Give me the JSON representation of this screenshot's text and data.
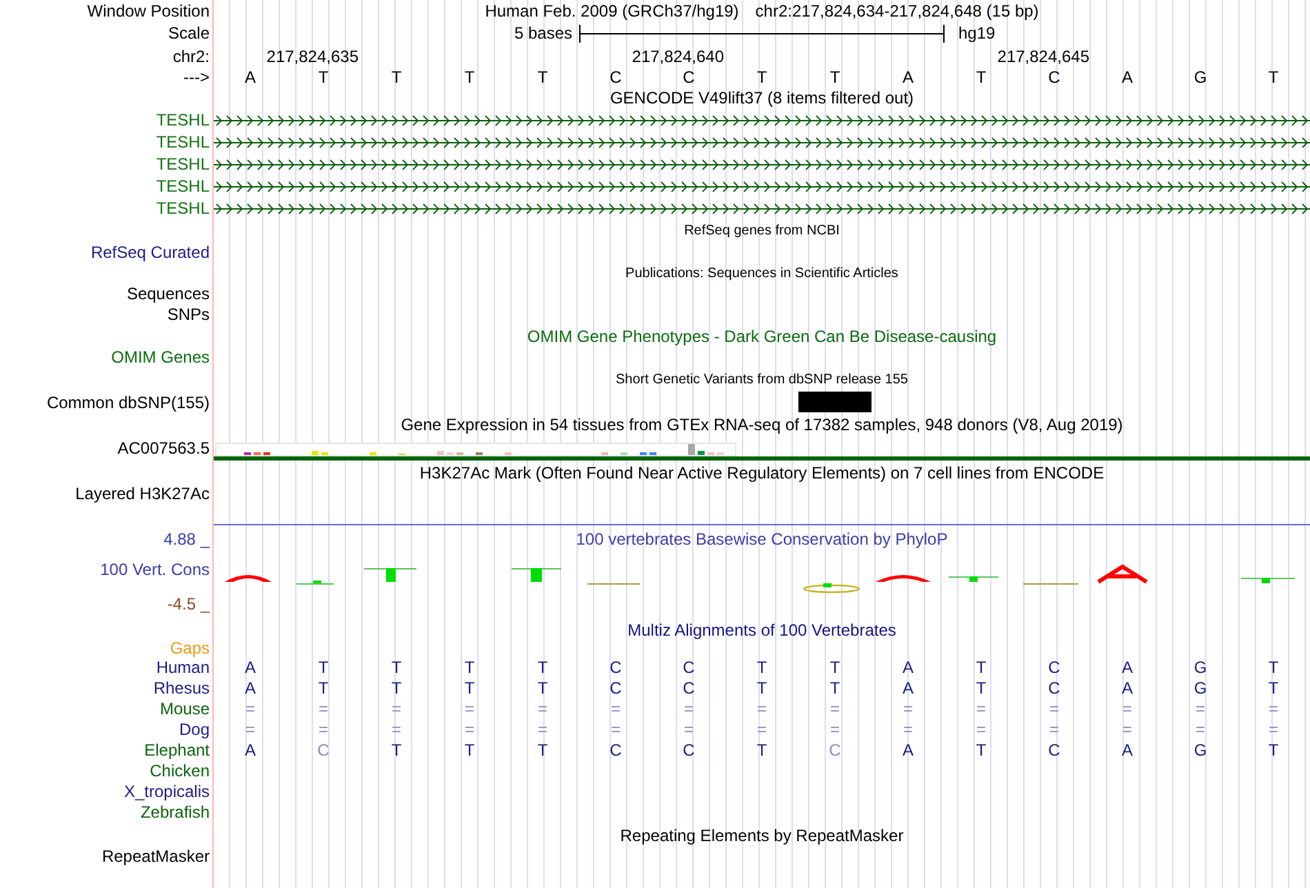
{
  "header": {
    "label": "Window Position",
    "assembly": "Human Feb. 2009 (GRCh37/hg19)",
    "position": "chr2:217,824,634-217,824,648 (15 bp)"
  },
  "scale": {
    "label": "Scale",
    "bar_label": "5 bases",
    "assembly": "hg19"
  },
  "ruler": {
    "label": "chr2:",
    "ticks": [
      "217,824,635",
      "217,824,640",
      "217,824,645"
    ]
  },
  "sequence": {
    "label": "--->",
    "bases": [
      "A",
      "T",
      "T",
      "T",
      "T",
      "C",
      "C",
      "T",
      "T",
      "A",
      "T",
      "C",
      "A",
      "G",
      "T"
    ]
  },
  "tracks": [
    {
      "kind": "gene",
      "title": "GENCODE V49lift37 (8 items filtered out)",
      "items": [
        {
          "label": "TESHL"
        },
        {
          "label": "TESHL"
        },
        {
          "label": "TESHL"
        },
        {
          "label": "TESHL"
        },
        {
          "label": "TESHL"
        }
      ]
    },
    {
      "kind": "refseq",
      "title": "RefSeq genes from NCBI",
      "labels": [
        "RefSeq Curated"
      ]
    },
    {
      "kind": "publications",
      "title": "Publications: Sequences in Scientific Articles",
      "labels": [
        "Sequences",
        "SNPs"
      ]
    },
    {
      "kind": "omim",
      "title": "OMIM Gene Phenotypes - Dark Green Can Be Disease-causing",
      "labels": [
        "OMIM Genes"
      ]
    },
    {
      "kind": "variants",
      "title": "Short Genetic Variants from dbSNP release 155",
      "labels": [
        "Common dbSNP(155)"
      ]
    },
    {
      "kind": "expression",
      "title": "Gene Expression in 54 tissues from GTEx RNA-seq of 17382 samples, 948 donors (V8, Aug 2019)",
      "labels": [
        "AC007563.5"
      ]
    },
    {
      "kind": "signal",
      "title": "H3K27Ac Mark (Often Found Near Active Regulatory Elements) on 7 cell lines from ENCODE",
      "labels": [
        "Layered H3K27Ac"
      ]
    },
    {
      "kind": "conservation",
      "title": "100 vertebrates Basewise Conservation by PhyloP",
      "labels": [
        "100 Vert. Cons"
      ],
      "max_label": "4.88 _",
      "min_label": "-4.5 _"
    },
    {
      "kind": "alignment",
      "title": "Multiz Alignments of 100 Vertebrates",
      "labels": [
        "Gaps"
      ],
      "species": [
        {
          "name": "Human",
          "color": "#1c1c84",
          "bases": [
            {
              "base": "A",
              "faded": false
            },
            {
              "base": "T",
              "faded": false
            },
            {
              "base": "T",
              "faded": false
            },
            {
              "base": "T",
              "faded": false
            },
            {
              "base": "T",
              "faded": false
            },
            {
              "base": "C",
              "faded": false
            },
            {
              "base": "C",
              "faded": false
            },
            {
              "base": "T",
              "faded": false
            },
            {
              "base": "T",
              "faded": false
            },
            {
              "base": "A",
              "faded": false
            },
            {
              "base": "T",
              "faded": false
            },
            {
              "base": "C",
              "faded": false
            },
            {
              "base": "A",
              "faded": false
            },
            {
              "base": "G",
              "faded": false
            },
            {
              "base": "T",
              "faded": false
            }
          ]
        },
        {
          "name": "Rhesus",
          "color": "#1c1c84",
          "bases": [
            {
              "base": "A",
              "faded": false
            },
            {
              "base": "T",
              "faded": false
            },
            {
              "base": "T",
              "faded": false
            },
            {
              "base": "T",
              "faded": false
            },
            {
              "base": "T",
              "faded": false
            },
            {
              "base": "C",
              "faded": false
            },
            {
              "base": "C",
              "faded": false
            },
            {
              "base": "T",
              "faded": false
            },
            {
              "base": "T",
              "faded": false
            },
            {
              "base": "A",
              "faded": false
            },
            {
              "base": "T",
              "faded": false
            },
            {
              "base": "C",
              "faded": false
            },
            {
              "base": "A",
              "faded": false
            },
            {
              "base": "G",
              "faded": false
            },
            {
              "base": "T",
              "faded": false
            }
          ]
        },
        {
          "name": "Mouse",
          "color": "#0c640c",
          "bases": [
            {
              "base": "=",
              "faded": true
            },
            {
              "base": "=",
              "faded": true
            },
            {
              "base": "=",
              "faded": true
            },
            {
              "base": "=",
              "faded": true
            },
            {
              "base": "=",
              "faded": true
            },
            {
              "base": "=",
              "faded": true
            },
            {
              "base": "=",
              "faded": true
            },
            {
              "base": "=",
              "faded": true
            },
            {
              "base": "=",
              "faded": true
            },
            {
              "base": "=",
              "faded": true
            },
            {
              "base": "=",
              "faded": true
            },
            {
              "base": "=",
              "faded": true
            },
            {
              "base": "=",
              "faded": true
            },
            {
              "base": "=",
              "faded": true
            },
            {
              "base": "=",
              "faded": true
            }
          ]
        },
        {
          "name": "Dog",
          "color": "#1c1c84",
          "bases": [
            {
              "base": "=",
              "faded": true
            },
            {
              "base": "=",
              "faded": true
            },
            {
              "base": "=",
              "faded": true
            },
            {
              "base": "=",
              "faded": true
            },
            {
              "base": "=",
              "faded": true
            },
            {
              "base": "=",
              "faded": true
            },
            {
              "base": "=",
              "faded": true
            },
            {
              "base": "=",
              "faded": true
            },
            {
              "base": "=",
              "faded": true
            },
            {
              "base": "=",
              "faded": true
            },
            {
              "base": "=",
              "faded": true
            },
            {
              "base": "=",
              "faded": true
            },
            {
              "base": "=",
              "faded": true
            },
            {
              "base": "=",
              "faded": true
            },
            {
              "base": "=",
              "faded": true
            }
          ]
        },
        {
          "name": "Elephant",
          "color": "#0c640c",
          "bases": [
            {
              "base": "A",
              "faded": false
            },
            {
              "base": "C",
              "faded": true
            },
            {
              "base": "T",
              "faded": false
            },
            {
              "base": "T",
              "faded": false
            },
            {
              "base": "T",
              "faded": false
            },
            {
              "base": "C",
              "faded": false
            },
            {
              "base": "C",
              "faded": false
            },
            {
              "base": "T",
              "faded": false
            },
            {
              "base": "C",
              "faded": true
            },
            {
              "base": "A",
              "faded": false
            },
            {
              "base": "T",
              "faded": false
            },
            {
              "base": "C",
              "faded": false
            },
            {
              "base": "A",
              "faded": false
            },
            {
              "base": "G",
              "faded": false
            },
            {
              "base": "T",
              "faded": false
            }
          ]
        },
        {
          "name": "Chicken",
          "color": "#0c640c"
        },
        {
          "name": "X_tropicalis",
          "color": "#1c1c84"
        },
        {
          "name": "Zebrafish",
          "color": "#0c640c"
        }
      ]
    },
    {
      "kind": "repeats",
      "title": "Repeating Elements by RepeatMasker",
      "labels": [
        "RepeatMasker"
      ]
    }
  ]
}
